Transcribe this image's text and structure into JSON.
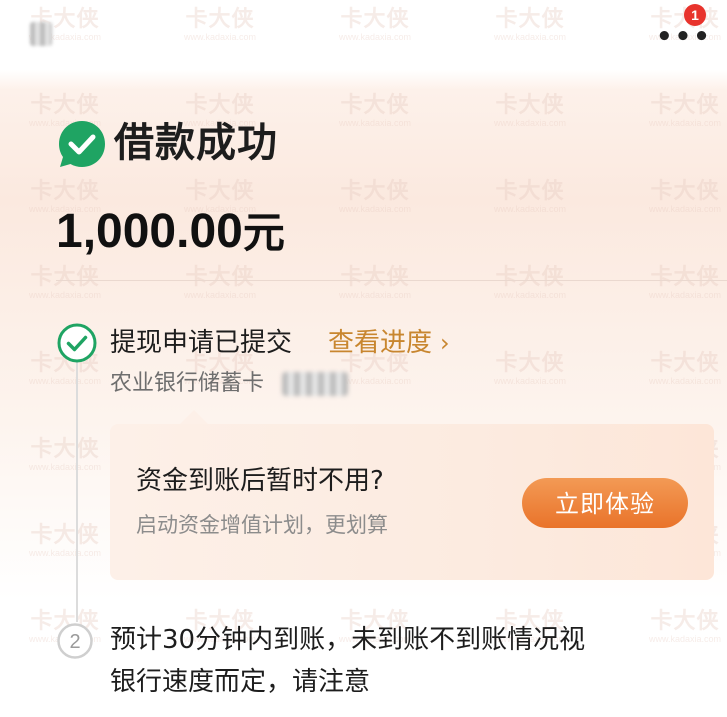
{
  "topbar": {
    "more_icon": "more-dots-icon",
    "notification_count": "1"
  },
  "watermark": {
    "text": "卡大侠",
    "url": "www.kadaxia.com"
  },
  "result": {
    "title": "借款成功",
    "amount": "1,000.00",
    "amount_unit": "元"
  },
  "steps": {
    "step1": {
      "title": "提现申请已提交",
      "link_label": "查看进度",
      "bank": "农业银行储蓄卡"
    },
    "step2": {
      "number": "2",
      "line1": "预计30分钟内到账，未到账不到账情况视",
      "line2": "银行速度而定，请注意"
    }
  },
  "promo": {
    "title": "资金到账后暂时不用?",
    "subtitle": "启动资金增值计划，更划算",
    "button_label": "立即体验"
  },
  "colors": {
    "success_green": "#1fa463",
    "accent_gold": "#c8862f",
    "button_orange": "#e9732a",
    "badge_red": "#e8332c"
  }
}
